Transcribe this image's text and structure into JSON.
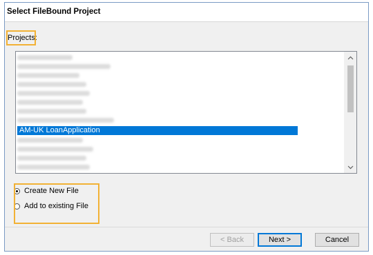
{
  "window": {
    "title": "Select FileBound Project"
  },
  "projects": {
    "label": "Projects:",
    "selected_item": "AM-UK LoanApplication",
    "scroll_up_icon": "chevron-up-icon",
    "scroll_down_icon": "chevron-down-icon"
  },
  "options": {
    "create_new": {
      "label": "Create New File",
      "checked": true
    },
    "add_existing": {
      "label": "Add to existing File",
      "checked": false
    }
  },
  "buttons": {
    "back": "< Back",
    "next": "Next >",
    "cancel": "Cancel"
  },
  "colors": {
    "selection": "#0078d7",
    "annotation_highlight": "#f2b134",
    "window_border": "#7a9ac4"
  }
}
